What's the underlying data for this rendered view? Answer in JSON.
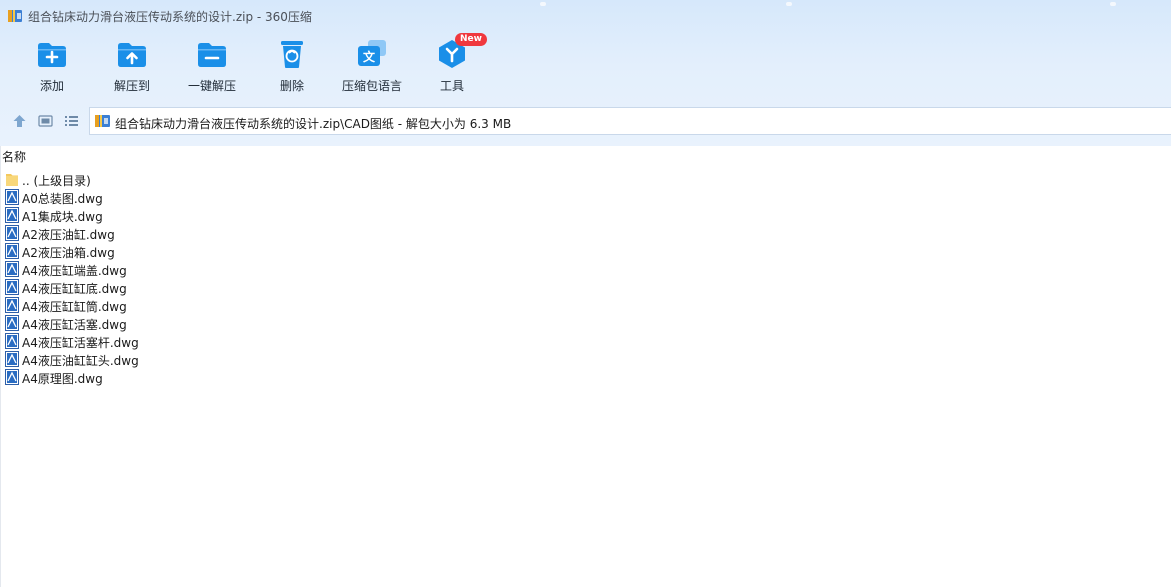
{
  "window": {
    "title": "组合钻床动力滑台液压传动系统的设计.zip - 360压缩"
  },
  "toolbar": {
    "buttons": [
      {
        "label": "添加",
        "icon": "folder-add-icon"
      },
      {
        "label": "解压到",
        "icon": "folder-extract-icon"
      },
      {
        "label": "一键解压",
        "icon": "folder-oneclick-extract-icon"
      },
      {
        "label": "删除",
        "icon": "recycle-bin-icon"
      },
      {
        "label": "压缩包语言",
        "icon": "language-icon"
      },
      {
        "label": "工具",
        "icon": "tools-icon"
      }
    ],
    "new_badge": "New"
  },
  "nav": {
    "up_icon": "arrow-up-icon",
    "thumb_view_icon": "thumbnail-view-icon",
    "list_view_icon": "list-view-icon",
    "address": "组合钻床动力滑台液压传动系统的设计.zip\\CAD图纸 - 解包大小为 6.3 MB"
  },
  "filelist": {
    "column_name": "名称",
    "items": [
      {
        "name": ".. (上级目录)",
        "type": "folder"
      },
      {
        "name": "A0总装图.dwg",
        "type": "dwg"
      },
      {
        "name": "A1集成块.dwg",
        "type": "dwg"
      },
      {
        "name": "A2液压油缸.dwg",
        "type": "dwg"
      },
      {
        "name": "A2液压油箱.dwg",
        "type": "dwg"
      },
      {
        "name": "A4液压缸端盖.dwg",
        "type": "dwg"
      },
      {
        "name": "A4液压缸缸底.dwg",
        "type": "dwg"
      },
      {
        "name": "A4液压缸缸筒.dwg",
        "type": "dwg"
      },
      {
        "name": "A4液压缸活塞.dwg",
        "type": "dwg"
      },
      {
        "name": "A4液压缸活塞杆.dwg",
        "type": "dwg"
      },
      {
        "name": "A4液压油缸缸头.dwg",
        "type": "dwg"
      },
      {
        "name": "A4原理图.dwg",
        "type": "dwg"
      }
    ]
  },
  "colors": {
    "accent": "#1a8fe8",
    "toolbar_bg": "#e3effc",
    "badge": "#f0383e"
  }
}
